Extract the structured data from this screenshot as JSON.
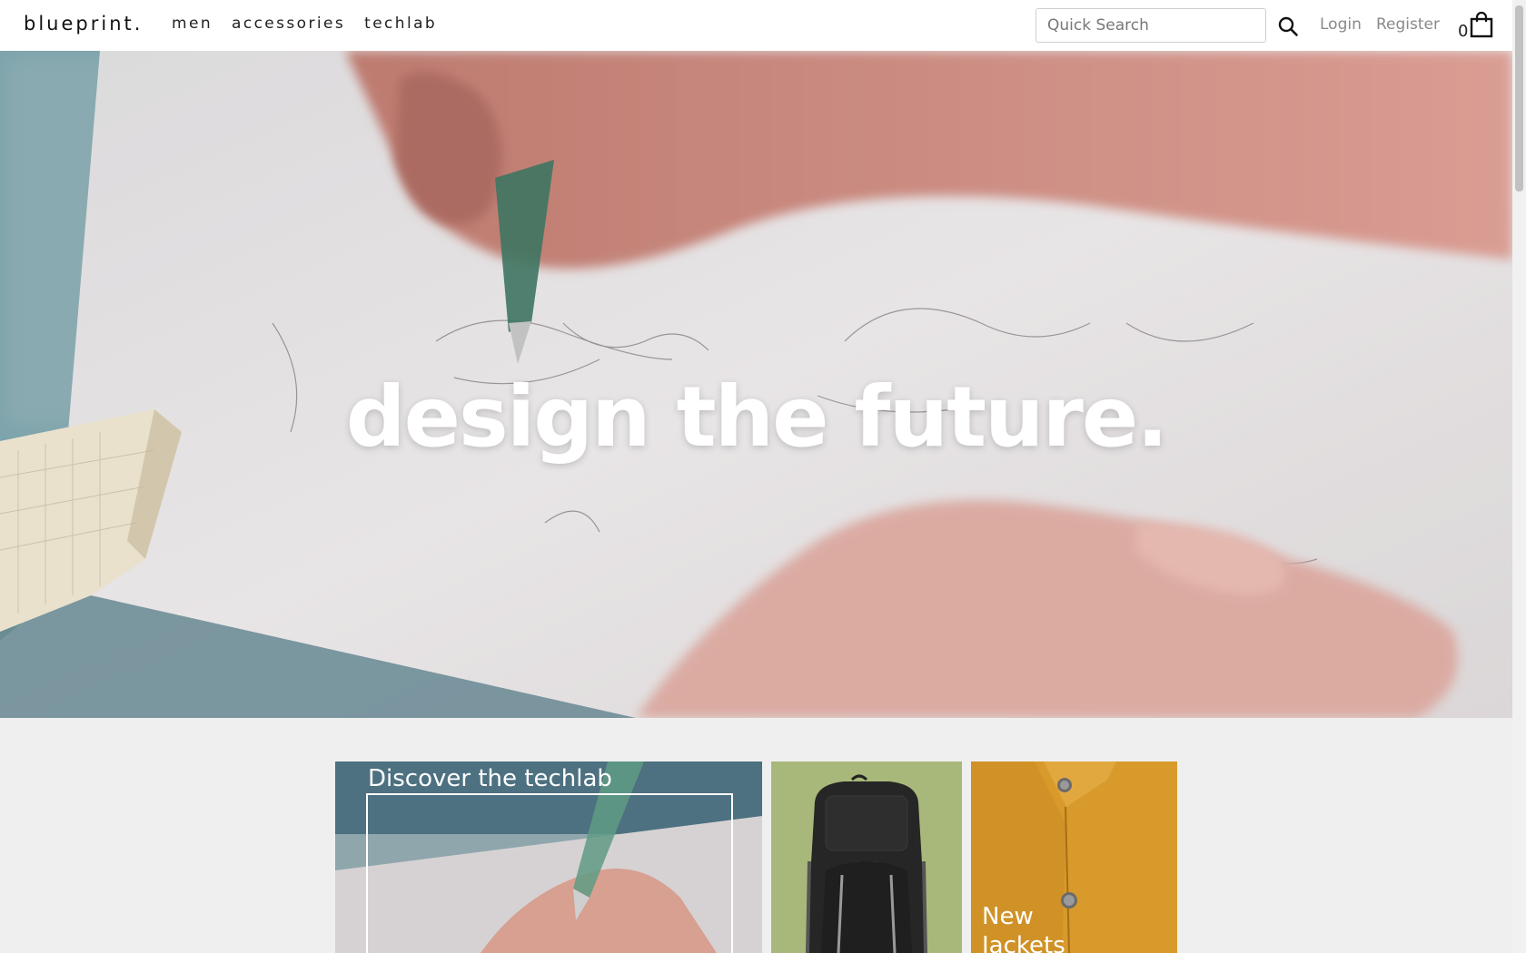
{
  "header": {
    "logo": "blueprint.",
    "nav": [
      "men",
      "accessories",
      "techlab"
    ],
    "search_placeholder": "Quick Search",
    "login_label": "Login",
    "register_label": "Register",
    "cart_count": "0"
  },
  "hero": {
    "title": "design the future."
  },
  "cards": {
    "techlab_title": "Discover the techlab",
    "jackets_title": "New Jackets"
  },
  "colors": {
    "backpack_bg": "#a8b87a",
    "jackets_bg": "#d79a2b"
  }
}
